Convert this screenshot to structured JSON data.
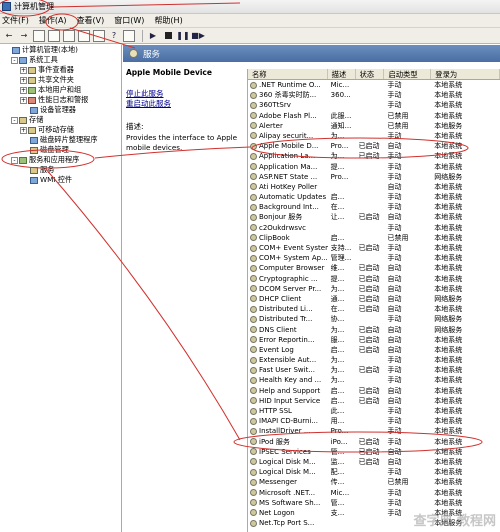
{
  "window": {
    "title": "计算机管理"
  },
  "menu": [
    "文件(F)",
    "操作(A)",
    "查看(V)",
    "窗口(W)",
    "帮助(H)"
  ],
  "tree": [
    {
      "label": "计算机管理(本地)",
      "indent": 0,
      "tw": "",
      "icon": "b"
    },
    {
      "label": "系统工具",
      "indent": 1,
      "tw": "-",
      "icon": "b"
    },
    {
      "label": "事件查看器",
      "indent": 2,
      "tw": "+",
      "icon": "y"
    },
    {
      "label": "共享文件夹",
      "indent": 2,
      "tw": "+",
      "icon": "y"
    },
    {
      "label": "本地用户和组",
      "indent": 2,
      "tw": "+",
      "icon": "g"
    },
    {
      "label": "性能日志和警报",
      "indent": 2,
      "tw": "+",
      "icon": "r"
    },
    {
      "label": "设备管理器",
      "indent": 2,
      "tw": "",
      "icon": "b"
    },
    {
      "label": "存储",
      "indent": 1,
      "tw": "-",
      "icon": "y"
    },
    {
      "label": "可移动存储",
      "indent": 2,
      "tw": "+",
      "icon": "y"
    },
    {
      "label": "磁盘碎片整理程序",
      "indent": 2,
      "tw": "",
      "icon": "b"
    },
    {
      "label": "磁盘管理",
      "indent": 2,
      "tw": "",
      "icon": "y"
    },
    {
      "label": "服务和应用程序",
      "indent": 1,
      "tw": "-",
      "icon": "g"
    },
    {
      "label": "服务",
      "indent": 2,
      "tw": "",
      "icon": "y"
    },
    {
      "label": "WMI 控件",
      "indent": 2,
      "tw": "",
      "icon": "b"
    }
  ],
  "panel": {
    "title": "服务"
  },
  "detail": {
    "name": "Apple Mobile Device",
    "stop_link": "停止此服务",
    "restart_link": "重启动此服务",
    "desc_label": "描述:",
    "desc_text": "Provides the interface to Apple mobile devices."
  },
  "columns": [
    "名称",
    "描述",
    "状态",
    "启动类型",
    "登录为"
  ],
  "services": [
    [
      ".NET Runtime O...",
      "Mic...",
      "",
      "手动",
      "本地系统"
    ],
    [
      "360 杀毒实时防...",
      "360...",
      "",
      "手动",
      "本地系统"
    ],
    [
      "360TtSrv",
      "",
      "",
      "手动",
      "本地系统"
    ],
    [
      "Adobe Flash Pl...",
      "此服...",
      "",
      "已禁用",
      "本地系统"
    ],
    [
      "Alerter",
      "通知...",
      "",
      "已禁用",
      "本地服务"
    ],
    [
      "Alipay securit...",
      "为...",
      "",
      "手动",
      "本地系统"
    ],
    [
      "Apple Mobile D...",
      "Pro...",
      "已启动",
      "自动",
      "本地系统"
    ],
    [
      "Application La...",
      "为...",
      "已启动",
      "手动",
      "本地系统"
    ],
    [
      "Application Ma...",
      "提...",
      "",
      "手动",
      "本地系统"
    ],
    [
      "ASP.NET State ...",
      "Pro...",
      "",
      "手动",
      "网络服务"
    ],
    [
      "Ati HotKey Poller",
      "",
      "",
      "自动",
      "本地系统"
    ],
    [
      "Automatic Updates",
      "启...",
      "",
      "手动",
      "本地系统"
    ],
    [
      "Background Int...",
      "在...",
      "",
      "手动",
      "本地系统"
    ],
    [
      "Bonjour 服务",
      "让...",
      "已启动",
      "自动",
      "本地系统"
    ],
    [
      "c2Oukdrwsvc",
      "",
      "",
      "手动",
      "本地系统"
    ],
    [
      "ClipBook",
      "启...",
      "",
      "已禁用",
      "本地系统"
    ],
    [
      "COM+ Event System",
      "支持...",
      "已启动",
      "手动",
      "本地系统"
    ],
    [
      "COM+ System Ap...",
      "管理...",
      "",
      "手动",
      "本地系统"
    ],
    [
      "Computer Browser",
      "维...",
      "已启动",
      "自动",
      "本地系统"
    ],
    [
      "Cryptographic ...",
      "提...",
      "已启动",
      "自动",
      "本地系统"
    ],
    [
      "DCOM Server Pr...",
      "为...",
      "已启动",
      "自动",
      "本地系统"
    ],
    [
      "DHCP Client",
      "通...",
      "已启动",
      "自动",
      "网络服务"
    ],
    [
      "Distributed Li...",
      "在...",
      "已启动",
      "自动",
      "本地系统"
    ],
    [
      "Distributed Tr...",
      "协...",
      "",
      "手动",
      "网络服务"
    ],
    [
      "DNS Client",
      "为...",
      "已启动",
      "自动",
      "网络服务"
    ],
    [
      "Error Reportin...",
      "服...",
      "已启动",
      "自动",
      "本地系统"
    ],
    [
      "Event Log",
      "启...",
      "已启动",
      "自动",
      "本地系统"
    ],
    [
      "Extensible Aut...",
      "为...",
      "",
      "手动",
      "本地系统"
    ],
    [
      "Fast User Swit...",
      "为...",
      "已启动",
      "手动",
      "本地系统"
    ],
    [
      "Health Key and ...",
      "为...",
      "",
      "手动",
      "本地系统"
    ],
    [
      "Help and Support",
      "启...",
      "已启动",
      "自动",
      "本地系统"
    ],
    [
      "HID Input Service",
      "启...",
      "已启动",
      "自动",
      "本地系统"
    ],
    [
      "HTTP SSL",
      "此...",
      "",
      "手动",
      "本地系统"
    ],
    [
      "IMAPI CD-Burni...",
      "用...",
      "",
      "手动",
      "本地系统"
    ],
    [
      "InstallDriver ...",
      "Pro...",
      "",
      "手动",
      "本地系统"
    ],
    [
      "iPod 服务",
      "iPo...",
      "已启动",
      "手动",
      "本地系统"
    ],
    [
      "IPSEC Services",
      "管...",
      "已启动",
      "自动",
      "本地系统"
    ],
    [
      "Logical Disk M...",
      "监...",
      "已启动",
      "自动",
      "本地系统"
    ],
    [
      "Logical Disk M...",
      "配...",
      "",
      "手动",
      "本地系统"
    ],
    [
      "Messenger",
      "传...",
      "",
      "已禁用",
      "本地系统"
    ],
    [
      "Microsoft .NET...",
      "Mic...",
      "",
      "手动",
      "本地系统"
    ],
    [
      "MS Software Sh...",
      "管...",
      "",
      "手动",
      "本地系统"
    ],
    [
      "Net Logon",
      "支...",
      "",
      "手动",
      "本地系统"
    ],
    [
      "Net.Tcp Port S...",
      "",
      "",
      "",
      "本地服务"
    ]
  ],
  "watermark": "查字典 教程网"
}
